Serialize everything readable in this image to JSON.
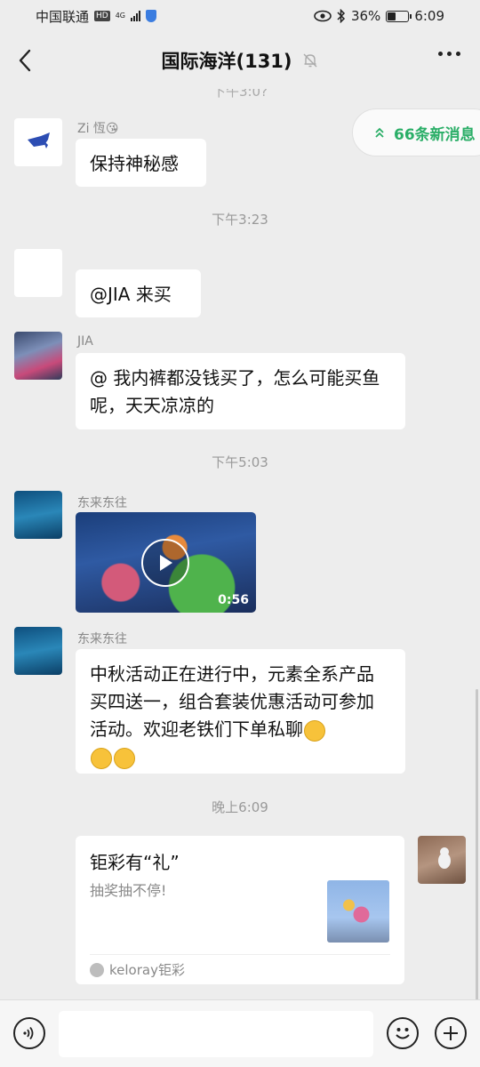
{
  "status_bar": {
    "carrier": "中国联通",
    "hd": "HD",
    "network": "4G",
    "battery_percent": "36%",
    "time": "6:09"
  },
  "header": {
    "title": "国际海洋(131)"
  },
  "new_messages": "66条新消息",
  "messages": {
    "m1": {
      "sender": "Zi  恆😘",
      "text": "保持神秘感"
    },
    "time1": "下午3:23",
    "m2": {
      "text": "@JIA  来买"
    },
    "m3": {
      "sender": "JIA",
      "text": "@ 我内裤都没钱买了，怎么可能买鱼呢，天天凉凉的"
    },
    "time2": "下午5:03",
    "m4": {
      "sender": "东来东往",
      "video_duration": "0:56"
    },
    "m5": {
      "sender": "东来东往",
      "text": "中秋活动正在进行中，元素全系产品买四送一，组合套装优惠活动可参加活动。欢迎老铁们下单私聊"
    },
    "time3": "晚上6:09",
    "m6": {
      "card_title": "钜彩有“礼”",
      "card_desc": "抽奖抽不停!",
      "card_source": "keloray钜彩"
    }
  },
  "colors": {
    "background": "#ededed",
    "bubble": "#ffffff",
    "accent_green": "#2aae67"
  }
}
